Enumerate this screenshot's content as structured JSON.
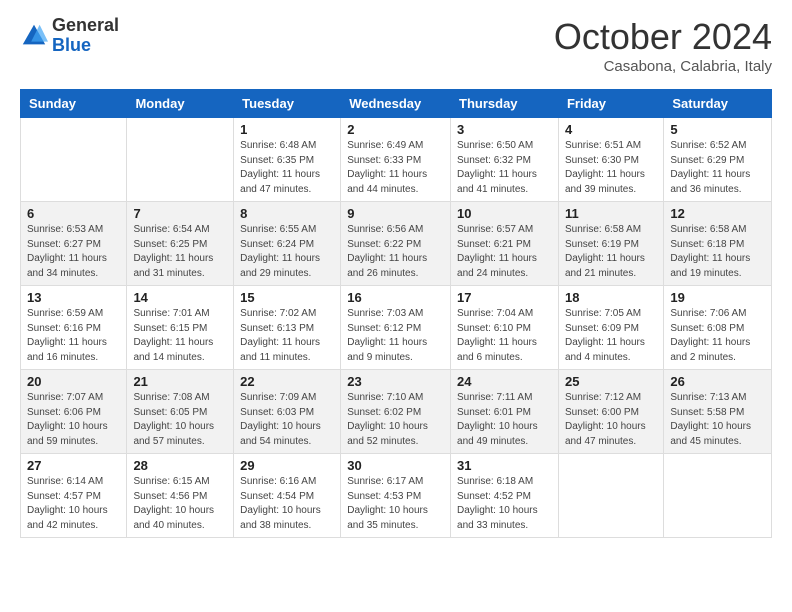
{
  "logo": {
    "general": "General",
    "blue": "Blue"
  },
  "header": {
    "month": "October 2024",
    "location": "Casabona, Calabria, Italy"
  },
  "weekdays": [
    "Sunday",
    "Monday",
    "Tuesday",
    "Wednesday",
    "Thursday",
    "Friday",
    "Saturday"
  ],
  "weeks": [
    [
      null,
      null,
      {
        "day": 1,
        "sunrise": "6:48 AM",
        "sunset": "6:35 PM",
        "daylight": "11 hours and 47 minutes."
      },
      {
        "day": 2,
        "sunrise": "6:49 AM",
        "sunset": "6:33 PM",
        "daylight": "11 hours and 44 minutes."
      },
      {
        "day": 3,
        "sunrise": "6:50 AM",
        "sunset": "6:32 PM",
        "daylight": "11 hours and 41 minutes."
      },
      {
        "day": 4,
        "sunrise": "6:51 AM",
        "sunset": "6:30 PM",
        "daylight": "11 hours and 39 minutes."
      },
      {
        "day": 5,
        "sunrise": "6:52 AM",
        "sunset": "6:29 PM",
        "daylight": "11 hours and 36 minutes."
      }
    ],
    [
      {
        "day": 6,
        "sunrise": "6:53 AM",
        "sunset": "6:27 PM",
        "daylight": "11 hours and 34 minutes."
      },
      {
        "day": 7,
        "sunrise": "6:54 AM",
        "sunset": "6:25 PM",
        "daylight": "11 hours and 31 minutes."
      },
      {
        "day": 8,
        "sunrise": "6:55 AM",
        "sunset": "6:24 PM",
        "daylight": "11 hours and 29 minutes."
      },
      {
        "day": 9,
        "sunrise": "6:56 AM",
        "sunset": "6:22 PM",
        "daylight": "11 hours and 26 minutes."
      },
      {
        "day": 10,
        "sunrise": "6:57 AM",
        "sunset": "6:21 PM",
        "daylight": "11 hours and 24 minutes."
      },
      {
        "day": 11,
        "sunrise": "6:58 AM",
        "sunset": "6:19 PM",
        "daylight": "11 hours and 21 minutes."
      },
      {
        "day": 12,
        "sunrise": "6:58 AM",
        "sunset": "6:18 PM",
        "daylight": "11 hours and 19 minutes."
      }
    ],
    [
      {
        "day": 13,
        "sunrise": "6:59 AM",
        "sunset": "6:16 PM",
        "daylight": "11 hours and 16 minutes."
      },
      {
        "day": 14,
        "sunrise": "7:01 AM",
        "sunset": "6:15 PM",
        "daylight": "11 hours and 14 minutes."
      },
      {
        "day": 15,
        "sunrise": "7:02 AM",
        "sunset": "6:13 PM",
        "daylight": "11 hours and 11 minutes."
      },
      {
        "day": 16,
        "sunrise": "7:03 AM",
        "sunset": "6:12 PM",
        "daylight": "11 hours and 9 minutes."
      },
      {
        "day": 17,
        "sunrise": "7:04 AM",
        "sunset": "6:10 PM",
        "daylight": "11 hours and 6 minutes."
      },
      {
        "day": 18,
        "sunrise": "7:05 AM",
        "sunset": "6:09 PM",
        "daylight": "11 hours and 4 minutes."
      },
      {
        "day": 19,
        "sunrise": "7:06 AM",
        "sunset": "6:08 PM",
        "daylight": "11 hours and 2 minutes."
      }
    ],
    [
      {
        "day": 20,
        "sunrise": "7:07 AM",
        "sunset": "6:06 PM",
        "daylight": "10 hours and 59 minutes."
      },
      {
        "day": 21,
        "sunrise": "7:08 AM",
        "sunset": "6:05 PM",
        "daylight": "10 hours and 57 minutes."
      },
      {
        "day": 22,
        "sunrise": "7:09 AM",
        "sunset": "6:03 PM",
        "daylight": "10 hours and 54 minutes."
      },
      {
        "day": 23,
        "sunrise": "7:10 AM",
        "sunset": "6:02 PM",
        "daylight": "10 hours and 52 minutes."
      },
      {
        "day": 24,
        "sunrise": "7:11 AM",
        "sunset": "6:01 PM",
        "daylight": "10 hours and 49 minutes."
      },
      {
        "day": 25,
        "sunrise": "7:12 AM",
        "sunset": "6:00 PM",
        "daylight": "10 hours and 47 minutes."
      },
      {
        "day": 26,
        "sunrise": "7:13 AM",
        "sunset": "5:58 PM",
        "daylight": "10 hours and 45 minutes."
      }
    ],
    [
      {
        "day": 27,
        "sunrise": "6:14 AM",
        "sunset": "4:57 PM",
        "daylight": "10 hours and 42 minutes."
      },
      {
        "day": 28,
        "sunrise": "6:15 AM",
        "sunset": "4:56 PM",
        "daylight": "10 hours and 40 minutes."
      },
      {
        "day": 29,
        "sunrise": "6:16 AM",
        "sunset": "4:54 PM",
        "daylight": "10 hours and 38 minutes."
      },
      {
        "day": 30,
        "sunrise": "6:17 AM",
        "sunset": "4:53 PM",
        "daylight": "10 hours and 35 minutes."
      },
      {
        "day": 31,
        "sunrise": "6:18 AM",
        "sunset": "4:52 PM",
        "daylight": "10 hours and 33 minutes."
      },
      null,
      null
    ]
  ],
  "labels": {
    "sunrise": "Sunrise:",
    "sunset": "Sunset:",
    "daylight": "Daylight:"
  }
}
